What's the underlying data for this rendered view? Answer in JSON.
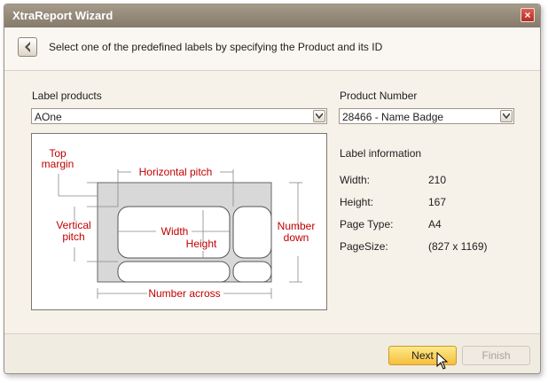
{
  "window": {
    "title": "XtraReport Wizard",
    "close_glyph": "×"
  },
  "header": {
    "back_icon": "arrow-left-icon",
    "instruction": "Select one of the predefined labels by specifying the Product and its ID"
  },
  "form": {
    "label_products_label": "Label products",
    "label_products_value": "AOne",
    "product_number_label": "Product Number",
    "product_number_value": "28466 - Name Badge"
  },
  "info": {
    "title": "Label information",
    "rows": [
      {
        "key": "Width:",
        "value": "210"
      },
      {
        "key": "Height:",
        "value": "167"
      },
      {
        "key": "Page Type:",
        "value": "A4"
      },
      {
        "key": "PageSize:",
        "value": "(827 x 1169)"
      }
    ]
  },
  "diagram": {
    "top_margin_1": "Top",
    "top_margin_2": "margin",
    "horizontal_pitch": "Horizontal pitch",
    "vertical_pitch_1": "Vertical",
    "vertical_pitch_2": "pitch",
    "width": "Width",
    "height": "Height",
    "number_down_1": "Number",
    "number_down_2": "down",
    "number_across": "Number across",
    "label_color": "#c00000"
  },
  "footer": {
    "next_label": "Next",
    "finish_label": "Finish"
  }
}
